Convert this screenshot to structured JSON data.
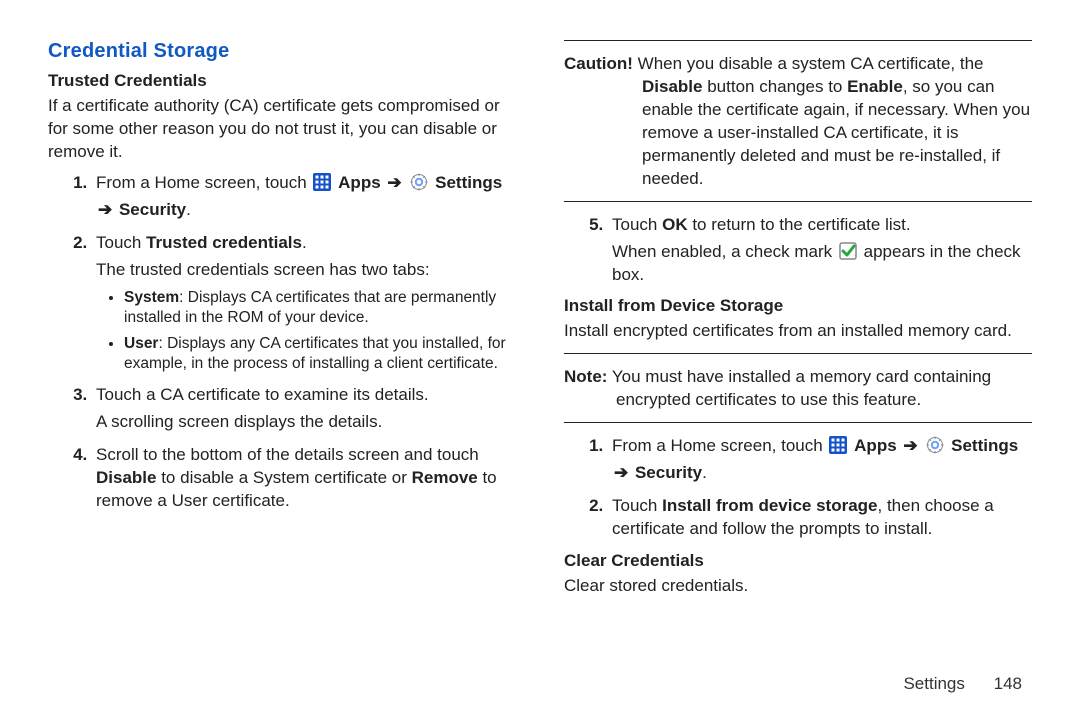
{
  "section_title": "Credential Storage",
  "trusted": {
    "heading": "Trusted Credentials",
    "intro": "If a certificate authority (CA) certificate gets compromised or for some other reason you do not trust it, you can disable or remove it.",
    "step1_prefix": "From a Home screen, touch ",
    "apps_label": "Apps",
    "settings_label": "Settings",
    "arrow": "➔",
    "step1_tail_a": "➔ ",
    "step1_tail_b": "Security",
    "step1_period": ".",
    "step2_prefix": "Touch ",
    "step2_bold": "Trusted credentials",
    "step2_suffix": ".",
    "step2_line2": "The trusted credentials screen has two tabs:",
    "bullet_system_label": "System",
    "bullet_system_text": ": Displays CA certificates that are permanently installed in the ROM of your device.",
    "bullet_user_label": "User",
    "bullet_user_text": ": Displays any CA certificates that you installed, for example, in the process of installing a client certificate.",
    "step3_line1": "Touch a CA certificate to examine its details.",
    "step3_line2": "A scrolling screen displays the details.",
    "step4_a": "Scroll to the bottom of the details screen and touch ",
    "step4_disable": "Disable",
    "step4_b": " to disable a System certificate or ",
    "step4_remove": "Remove",
    "step4_c": " to remove a User certificate."
  },
  "caution": {
    "label": "Caution!",
    "text_a": " When you disable a system CA certificate, the ",
    "disable_word": "Disable",
    "text_b": " button changes to ",
    "enable_word": "Enable",
    "text_c": ", so you can enable the certificate again, if necessary. When you remove a user-installed CA certificate, it is permanently deleted and must be re-installed, if needed."
  },
  "step5": {
    "a": "Touch ",
    "ok": "OK",
    "b": " to return to the certificate list.",
    "line2_a": "When enabled, a check mark ",
    "line2_b": " appears in the check box."
  },
  "install": {
    "heading": "Install from Device Storage",
    "intro": "Install encrypted certificates from an installed memory card.",
    "note_label": "Note:",
    "note_text": " You must have installed a memory card containing encrypted certificates to use this feature.",
    "step1_prefix": "From a Home screen, touch ",
    "step2_a": "Touch ",
    "step2_bold": "Install from device storage",
    "step2_b": ", then choose a certificate and follow the prompts to install."
  },
  "clear": {
    "heading": "Clear Credentials",
    "text": "Clear stored credentials."
  },
  "footer": {
    "section": "Settings",
    "page": "148"
  }
}
